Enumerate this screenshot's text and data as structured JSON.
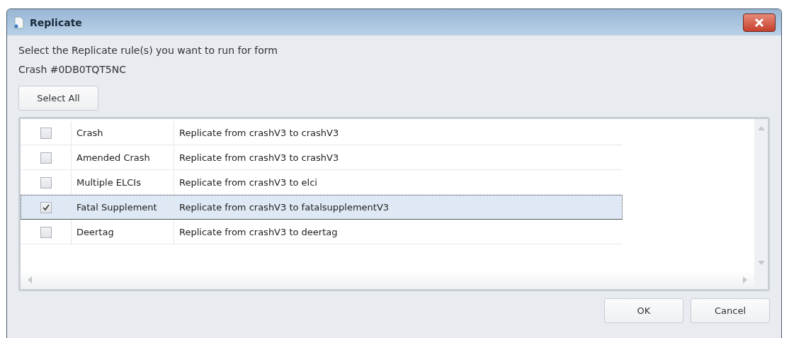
{
  "window": {
    "title": "Replicate"
  },
  "prompt": [
    "Select the Replicate rule(s) you want to run for form",
    "Crash #0DB0TQT5NC"
  ],
  "select_all_button": "Select All",
  "rules": [
    {
      "name": "Crash",
      "description": "Replicate from crashV3 to crashV3",
      "checked": false,
      "selected": false
    },
    {
      "name": "Amended Crash",
      "description": "Replicate from crashV3 to crashV3",
      "checked": false,
      "selected": false
    },
    {
      "name": "Multiple ELCIs",
      "description": "Replicate from crashV3 to elci",
      "checked": false,
      "selected": false
    },
    {
      "name": "Fatal Supplement",
      "description": "Replicate from crashV3 to fatalsupplementV3",
      "checked": true,
      "selected": true
    },
    {
      "name": "Deertag",
      "description": "Replicate from crashV3 to deertag",
      "checked": false,
      "selected": false
    }
  ],
  "buttons": [
    "OK",
    "Cancel"
  ]
}
